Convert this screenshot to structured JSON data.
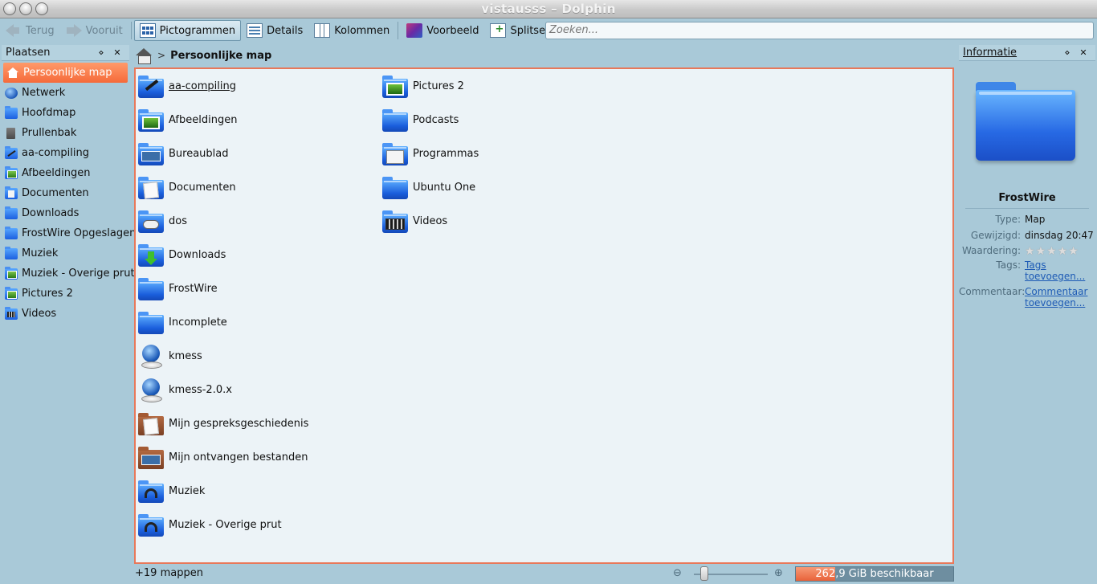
{
  "window": {
    "title": "vistausss – Dolphin"
  },
  "toolbar": {
    "back": "Terug",
    "forward": "Vooruit",
    "icons_view": "Pictogrammen",
    "details_view": "Details",
    "columns_view": "Kolommen",
    "preview": "Voorbeeld",
    "split": "Splitsen",
    "search_placeholder": "Zoeken..."
  },
  "places": {
    "title": "Plaatsen",
    "items": [
      {
        "label": "Persoonlijke map",
        "icon": "home-icon",
        "active": true
      },
      {
        "label": "Netwerk",
        "icon": "network-icon"
      },
      {
        "label": "Hoofdmap",
        "icon": "folder-icon"
      },
      {
        "label": "Prullenbak",
        "icon": "trash-icon"
      },
      {
        "label": "aa-compiling",
        "icon": "folder-tools-icon"
      },
      {
        "label": "Afbeeldingen",
        "icon": "folder-images-icon"
      },
      {
        "label": "Documenten",
        "icon": "folder-documents-icon"
      },
      {
        "label": "Downloads",
        "icon": "folder-icon"
      },
      {
        "label": "FrostWire Opgeslagen",
        "icon": "folder-icon"
      },
      {
        "label": "Muziek",
        "icon": "folder-icon"
      },
      {
        "label": "Muziek - Overige prut",
        "icon": "folder-images-icon"
      },
      {
        "label": "Pictures 2",
        "icon": "folder-images-icon"
      },
      {
        "label": "Videos",
        "icon": "folder-videos-icon"
      }
    ]
  },
  "breadcrumb": {
    "current": "Persoonlijke map"
  },
  "files": {
    "column1": [
      {
        "name": "aa-compiling",
        "icon": "folder-tools-icon"
      },
      {
        "name": "Afbeeldingen",
        "icon": "folder-images-icon"
      },
      {
        "name": "Bureaublad",
        "icon": "folder-desktop-icon"
      },
      {
        "name": "Documenten",
        "icon": "folder-documents-icon"
      },
      {
        "name": "dos",
        "icon": "folder-games-icon"
      },
      {
        "name": "Downloads",
        "icon": "folder-downloads-icon"
      },
      {
        "name": "FrostWire",
        "icon": "folder-icon"
      },
      {
        "name": "Incomplete",
        "icon": "folder-icon"
      },
      {
        "name": "kmess",
        "icon": "globe-icon"
      },
      {
        "name": "kmess-2.0.x",
        "icon": "globe-icon"
      },
      {
        "name": "Mijn gespreksgeschiedenis",
        "icon": "brown-folder-documents-icon"
      },
      {
        "name": "Mijn ontvangen bestanden",
        "icon": "brown-folder-desktop-icon"
      },
      {
        "name": "Muziek",
        "icon": "folder-music-icon"
      },
      {
        "name": "Muziek - Overige prut",
        "icon": "folder-music-icon"
      }
    ],
    "column2": [
      {
        "name": "Pictures 2",
        "icon": "folder-images-icon"
      },
      {
        "name": "Podcasts",
        "icon": "folder-icon"
      },
      {
        "name": "Programmas",
        "icon": "folder-programs-icon"
      },
      {
        "name": "Ubuntu One",
        "icon": "folder-icon"
      },
      {
        "name": "Videos",
        "icon": "folder-videos-icon"
      }
    ]
  },
  "info": {
    "title": "Informatie",
    "name": "FrostWire",
    "type_label": "Type:",
    "type_value": "Map",
    "modified_label": "Gewijzigd:",
    "modified_value": "dinsdag 20:47",
    "rating_label": "Waardering:",
    "rating_value": 0,
    "rating_max": 5,
    "tags_label": "Tags:",
    "tags_link": "Tags toevoegen...",
    "comment_label": "Commentaar:",
    "comment_link": "Commentaar toevoegen..."
  },
  "status": {
    "count": "+19 mappen",
    "free_space": "262,9 GiB beschikbaar",
    "used_fraction": 0.25
  }
}
